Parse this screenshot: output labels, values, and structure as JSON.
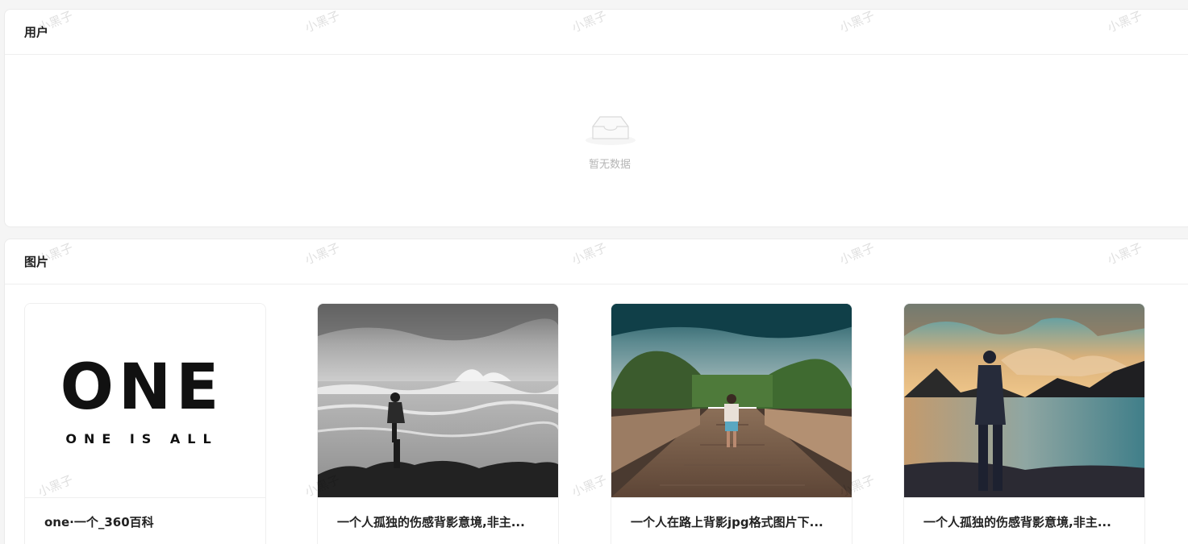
{
  "users_section": {
    "title": "用户",
    "empty_text": "暂无数据",
    "empty_icon": "inbox-icon"
  },
  "images_section": {
    "title": "图片",
    "items": [
      {
        "caption": "one·一个_360百科",
        "logo_main": "ONE",
        "logo_sub": "ONE IS ALL"
      },
      {
        "caption": "一个人孤独的伤感背影意境,非主..."
      },
      {
        "caption": "一个人在路上背影jpg格式图片下..."
      },
      {
        "caption": "一个人孤独的伤感背影意境,非主..."
      }
    ]
  },
  "watermark": "小黑子"
}
